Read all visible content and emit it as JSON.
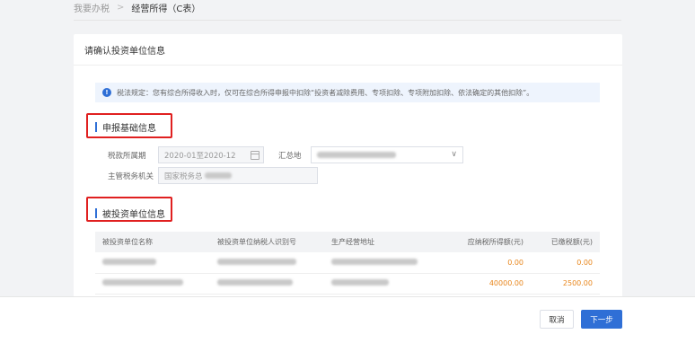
{
  "breadcrumb": {
    "parent": "我要办税",
    "separator": ">",
    "current": "经营所得（C表）"
  },
  "card": {
    "title": "请确认投资单位信息"
  },
  "notice": {
    "icon": "info-icon",
    "text": "税法规定：您有综合所得收入时，仅可在综合所得申报中扣除“投资者减除费用、专项扣除、专项附加扣除、依法确定的其他扣除”。"
  },
  "basic_section": {
    "title": "申报基础信息",
    "period_label": "税款所属期",
    "period_value": "2020-01至2020-12",
    "location_label": "汇总地",
    "authority_label": "主管税务机关",
    "authority_value": "国家税务总"
  },
  "investee_section": {
    "title": "被投资单位信息",
    "columns": [
      "被投资单位名称",
      "被投资单位纳税人识别号",
      "生产经营地址",
      "应纳税所得额(元)",
      "已缴税额(元)"
    ],
    "rows": [
      {
        "taxable": "0.00",
        "paid": "0.00"
      },
      {
        "taxable": "40000.00",
        "paid": "2500.00"
      }
    ]
  },
  "footer": {
    "cancel_label": "取消",
    "next_label": "下一步"
  },
  "colors": {
    "accent": "#2f6fd6",
    "highlight": "#e02020",
    "amount": "#e8861c"
  }
}
